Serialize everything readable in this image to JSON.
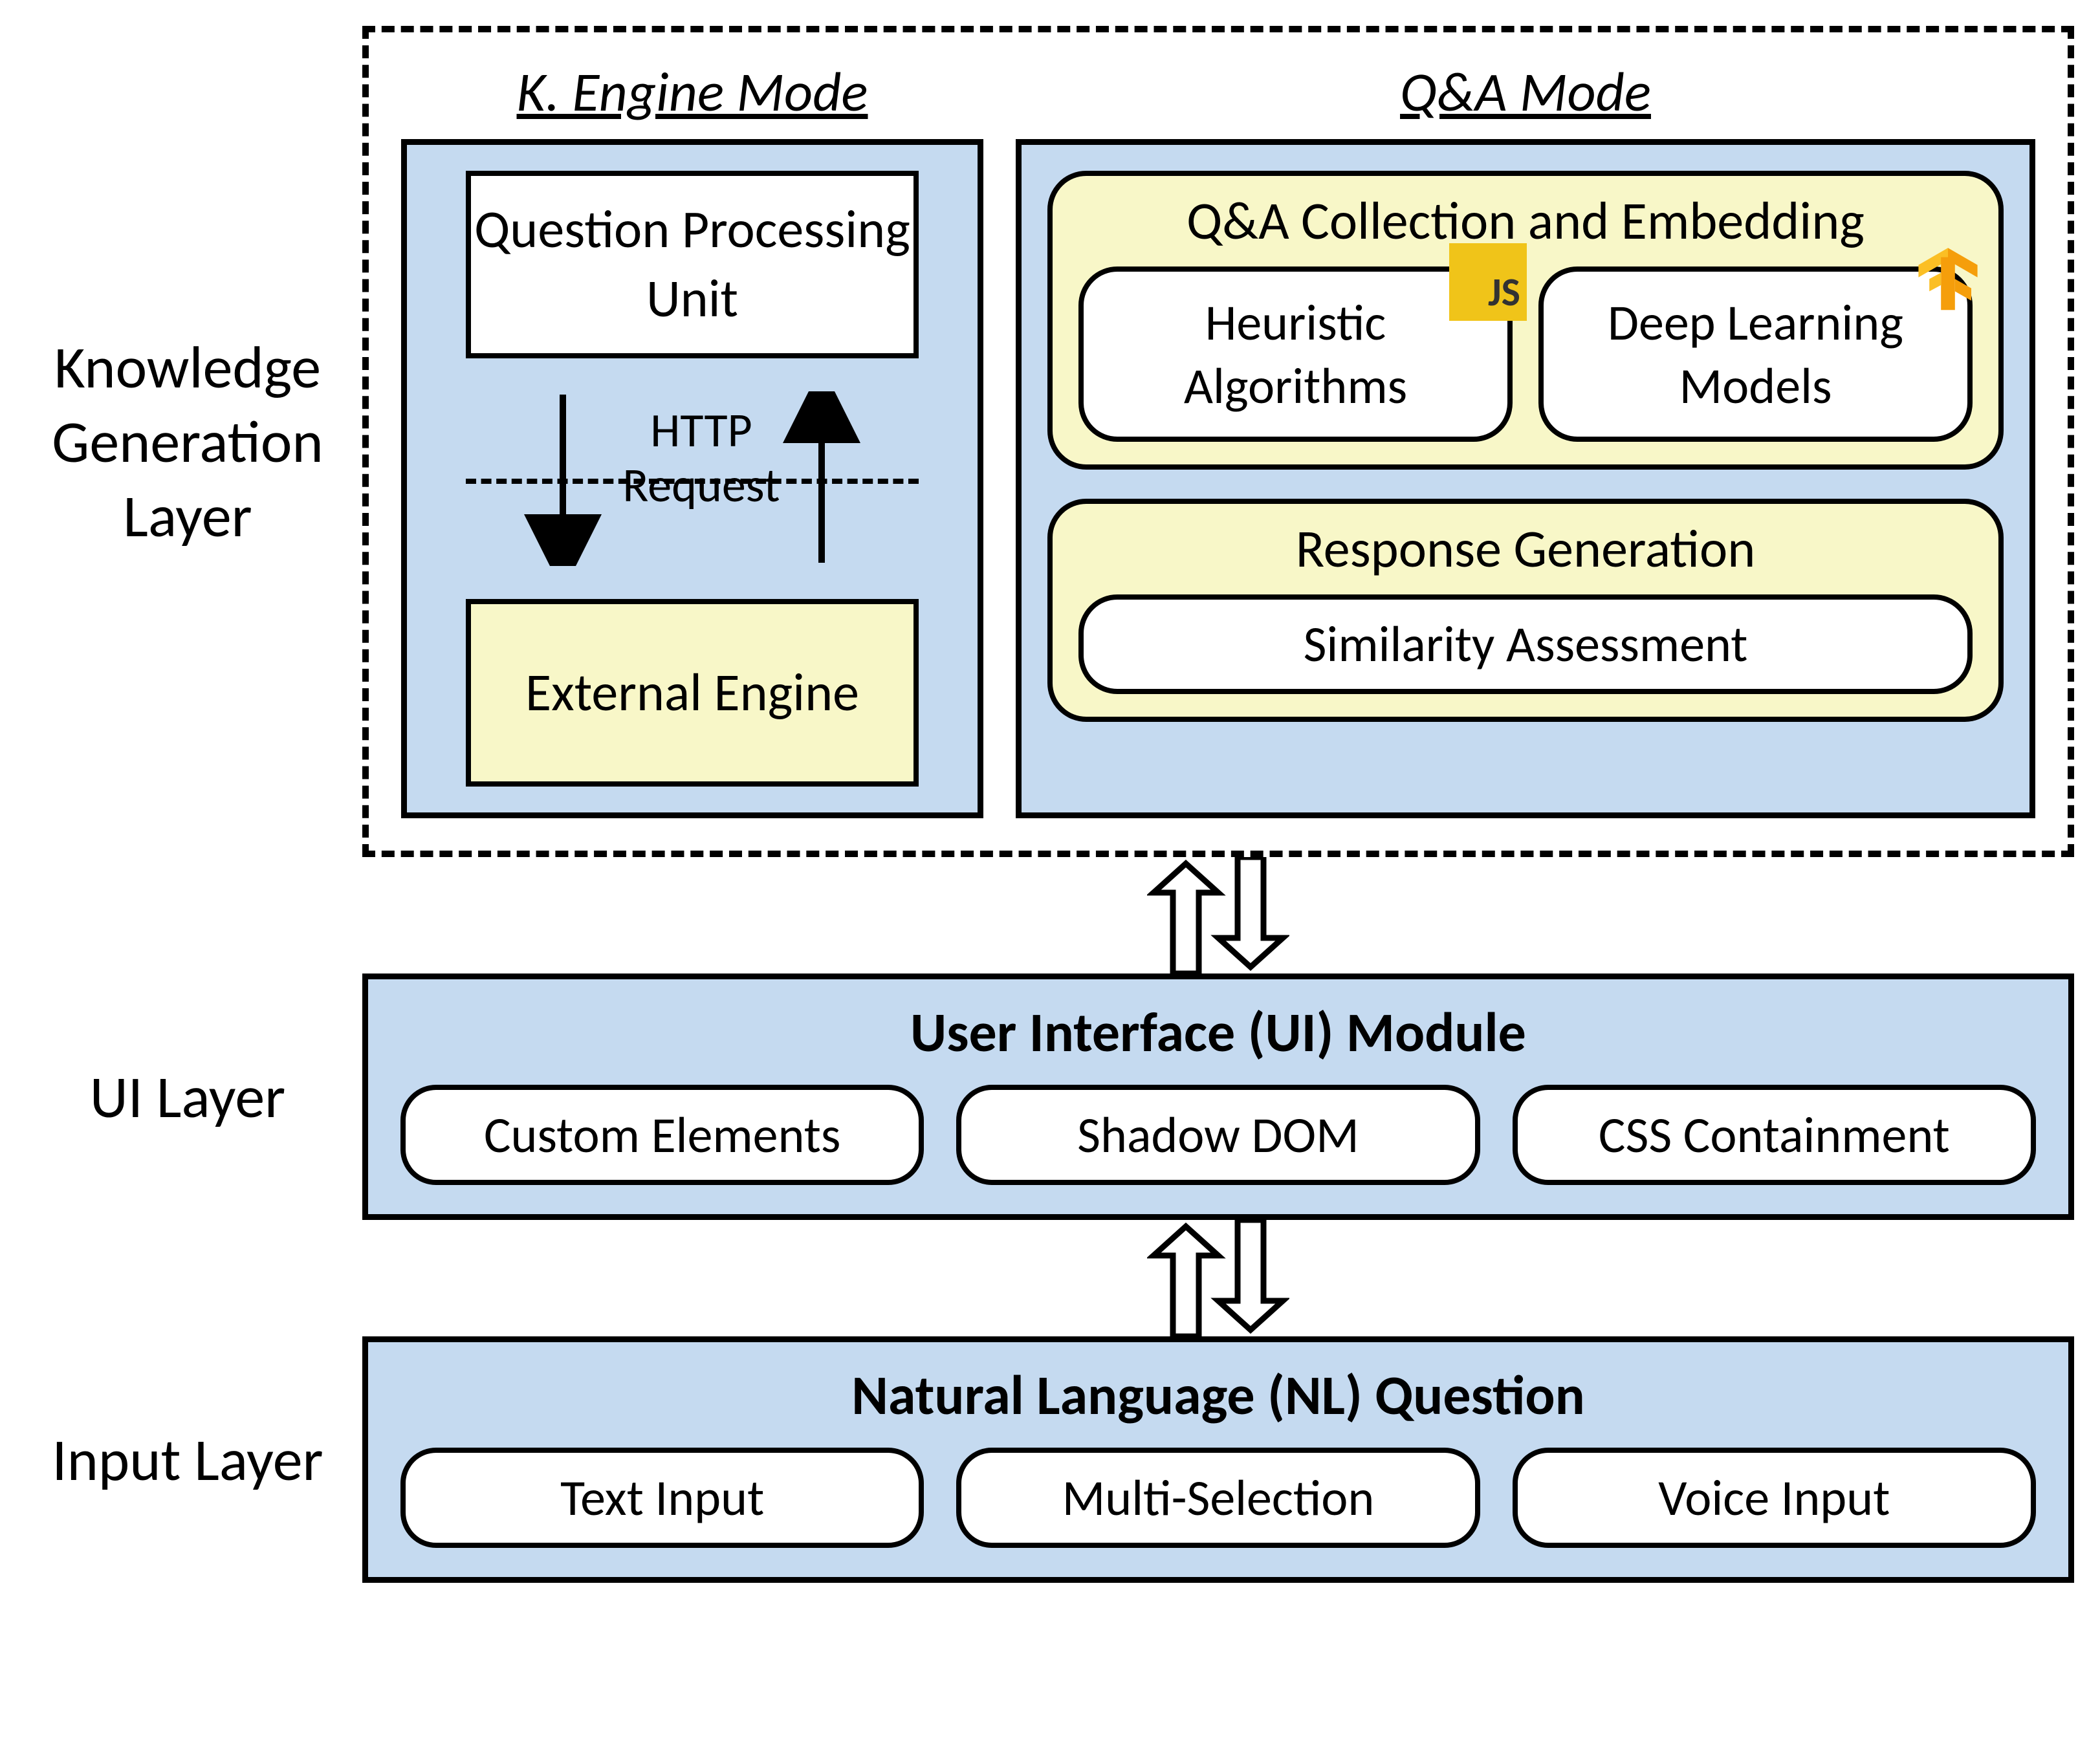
{
  "layers": {
    "knowledge": {
      "label": "Knowledge Generation Layer",
      "k_engine": {
        "mode_title": "K. Engine Mode",
        "question_processing": "Question Processing Unit",
        "http_label": "HTTP Request",
        "external_engine": "External Engine"
      },
      "qa": {
        "mode_title": "Q&A Mode",
        "collection_title": "Q&A Collection and Embedding",
        "heuristic": "Heuristic Algorithms",
        "deep_learning": "Deep Learning Models",
        "response_title": "Response Generation",
        "similarity": "Similarity Assessment",
        "badge_js": "JS"
      }
    },
    "ui": {
      "label": "UI Layer",
      "title": "User Interface (UI) Module",
      "items": [
        "Custom Elements",
        "Shadow DOM",
        "CSS Containment"
      ]
    },
    "input": {
      "label": "Input Layer",
      "title": "Natural Language (NL) Question",
      "items": [
        "Text Input",
        "Multi-Selection",
        "Voice Input"
      ]
    }
  },
  "colors": {
    "panel_blue": "#c5daf0",
    "panel_yellow": "#f8f7c8",
    "js_badge": "#f0c419",
    "tf_orange": "#f59e0b"
  }
}
